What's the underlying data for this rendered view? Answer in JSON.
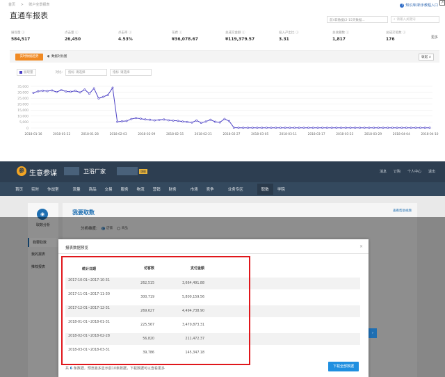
{
  "top": {
    "breadcrumb": [
      "首页",
      ">",
      "账户全景报表"
    ],
    "title": "直通车报表",
    "help_link": "知识库/新手教程入口",
    "date_select": "前4日数据(2-15天数据...",
    "search_placeholder": "请输入关键词",
    "kpis": [
      {
        "label": "展现量",
        "value": "584,517"
      },
      {
        "label": "点击量",
        "value": "26,450"
      },
      {
        "label": "点击率",
        "value": "4.53%"
      },
      {
        "label": "花费",
        "value": "¥36,078.67"
      },
      {
        "label": "总成交金额",
        "value": "¥119,379.57"
      },
      {
        "label": "投入产出比",
        "value": "3.31"
      },
      {
        "label": "总收藏数",
        "value": "1,817"
      },
      {
        "label": "总成交笔数",
        "value": "176"
      }
    ],
    "kpi_more": "更多",
    "tabs": [
      {
        "label": "实时数据趋势"
      },
      {
        "label": "数据对比图"
      }
    ],
    "collapse_label": "收起",
    "filters": {
      "indicator_label": "展现量",
      "compare_label": "对比:",
      "f1": "指标",
      "f1_value": "请选择",
      "f2": "指标",
      "f2_value": "请选择"
    }
  },
  "chart_data": {
    "type": "line",
    "y_ticks": [
      "35,000",
      "30,000",
      "25,000",
      "20,000",
      "15,000",
      "10,000",
      "5,000",
      "0"
    ],
    "ylim": [
      0,
      35000
    ],
    "x_ticks": [
      "2018-01-16",
      "2018-01-22",
      "2018-01-28",
      "2018-02-03",
      "2018-02-09",
      "2018-02-15",
      "2018-02-21",
      "2018-02-27",
      "2018-03-05",
      "2018-03-11",
      "2018-03-17",
      "2018-03-23",
      "2018-03-29",
      "2018-04-04",
      "2018-04-10"
    ],
    "values": [
      29500,
      30800,
      31200,
      30900,
      31500,
      30200,
      31800,
      30600,
      30400,
      31200,
      29800,
      32200,
      28800,
      33200,
      24800,
      26200,
      27800,
      33800,
      5200,
      5600,
      5900,
      7500,
      8300,
      7800,
      7200,
      6900,
      6400,
      6800,
      7100,
      6500,
      6200,
      6000,
      5400,
      5100,
      4600,
      6300,
      4300,
      5400,
      6900,
      5200,
      4700,
      7600,
      5800,
      300,
      200,
      200,
      200,
      200,
      200,
      200,
      200,
      200,
      200,
      200,
      200,
      200,
      200,
      200,
      200,
      200,
      200,
      200,
      200,
      200,
      200,
      200,
      200,
      200,
      200,
      200,
      200,
      200,
      200,
      200,
      200,
      200,
      200,
      200,
      200,
      200,
      200,
      200,
      200,
      200,
      200,
      200
    ],
    "color": "#4a3fc4"
  },
  "app": {
    "logo_glyph": "参",
    "name": "生意参谋",
    "shop": "卫浴厂家",
    "badge": "旗舰",
    "header_right": [
      "消息",
      "订购",
      "个人中心",
      "退出"
    ],
    "nav": [
      "首页",
      "实时",
      "作战室",
      "流量",
      "商品",
      "交易",
      "服务",
      "物流",
      "营销",
      "财务",
      "市场",
      "竞争",
      "业务专区",
      "取数",
      "学院"
    ],
    "nav_active": "取数",
    "side_title": "取数分析",
    "side_items": [
      "我要取数",
      "我的报表",
      "推荐报表"
    ],
    "main_title": "我要取数",
    "main_link": "查看帮助视频",
    "dim_label": "分析维度:",
    "dim_options": [
      "店铺",
      "商品"
    ],
    "modal": {
      "title": "报表数据预览",
      "close": "×",
      "columns": [
        "统计日期",
        "访客数",
        "支付金额"
      ],
      "rows": [
        {
          "date": "2017-10-01~2017-10-31",
          "visitors": "262,515",
          "amount": "3,664,491.88"
        },
        {
          "date": "2017-11-01~2017-11-30",
          "visitors": "300,719",
          "amount": "5,800,159.56"
        },
        {
          "date": "2017-12-01~2017-12-31",
          "visitors": "269,627",
          "amount": "4,494,738.90"
        },
        {
          "date": "2018-01-01~2018-01-31",
          "visitors": "225,567",
          "amount": "3,470,873.31"
        },
        {
          "date": "2018-02-01~2018-02-28",
          "visitors": "56,820",
          "amount": "211,472.37"
        },
        {
          "date": "2018-03-01~2018-03-31",
          "visitors": "39,786",
          "amount": "145,347.18"
        }
      ],
      "foot_prefix": "共",
      "foot_count": "6",
      "foot_suffix": "条数据，预览最多显示前10条数据，下载数据可以查看更多",
      "download": "下载全部数据"
    }
  }
}
